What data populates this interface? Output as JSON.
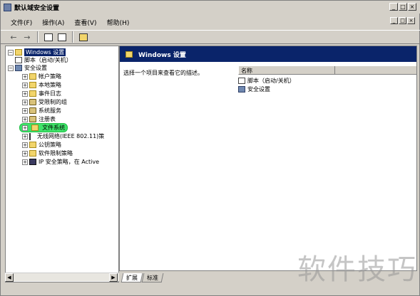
{
  "window": {
    "title": "默认域安全设置"
  },
  "menu": {
    "items": [
      "文件(F)",
      "操作(A)",
      "查看(V)",
      "帮助(H)"
    ]
  },
  "tree": {
    "root": "Windows 设置",
    "items": [
      "脚本（启动/关机）",
      "安全设置",
      "帐户策略",
      "本地策略",
      "事件日志",
      "受限制的组",
      "系统服务",
      "注册表",
      "文件系统",
      "无线网络(IEEE 802.11)策",
      "公钥策略",
      "软件限制策略",
      "IP 安全策略，在 Active"
    ]
  },
  "right_pane": {
    "header": "Windows 设置",
    "description": "选择一个项目来查看它的描述。",
    "column_name": "名称",
    "list": [
      "脚本（启动/关机）",
      "安全设置"
    ]
  },
  "tabs": [
    "扩展",
    "标准"
  ],
  "watermark": "软件技巧"
}
